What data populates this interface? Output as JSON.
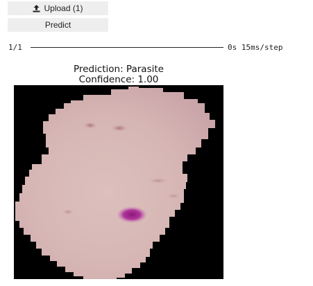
{
  "upload": {
    "label": "Upload (1)",
    "icon": "upload-icon"
  },
  "predict": {
    "label": "Predict"
  },
  "progress": {
    "step": "1/1",
    "time": "0s 15ms/step",
    "fraction": 1.0
  },
  "result": {
    "title": "Prediction: Parasite",
    "confidence": "Confidence: 1.00"
  },
  "image": {
    "description_icon": "cell-image",
    "background_color": "#000000",
    "cell_color": "#d8bbbb",
    "stain_color": "#b0329a"
  }
}
